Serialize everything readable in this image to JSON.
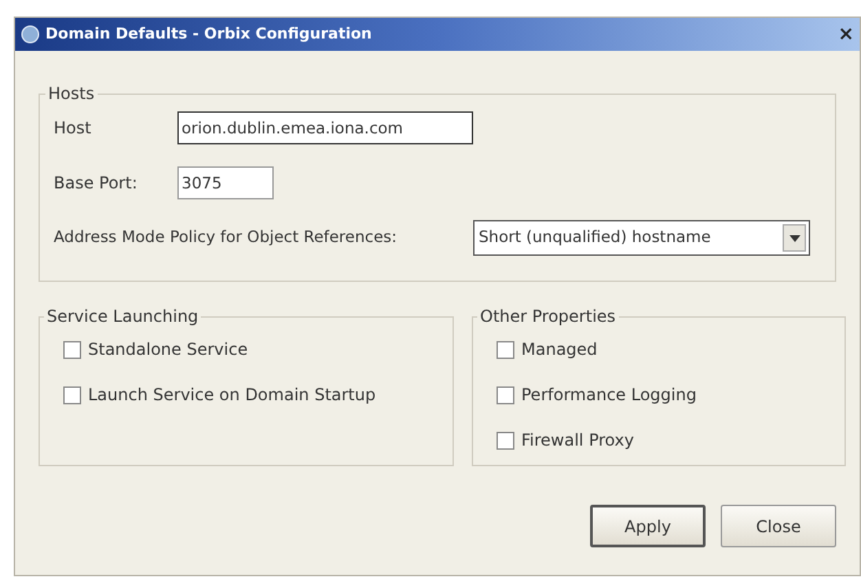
{
  "window": {
    "title": "Domain Defaults - Orbix Configuration",
    "close": "×"
  },
  "hosts": {
    "title": "Hosts",
    "fields": [
      {
        "label": "Host",
        "value": "orion.dublin.emea.iona.com",
        "focused": true
      },
      {
        "label": "Base Port:",
        "value": "3075",
        "focused": false
      }
    ],
    "policy": {
      "label": "Address Mode Policy for Object References:",
      "value": "Short (unqualified) hostname"
    }
  },
  "groups": [
    {
      "title": "Service Launching",
      "checkboxes": [
        {
          "label": "Standalone Service",
          "checked": false
        },
        {
          "label": "Launch Service on Domain Startup",
          "checked": false
        }
      ]
    },
    {
      "title": "Other Properties",
      "checkboxes": [
        {
          "label": "Managed",
          "checked": false
        },
        {
          "label": "Performance Logging",
          "checked": false
        },
        {
          "label": "Firewall Proxy",
          "checked": false
        }
      ]
    }
  ],
  "buttons": [
    {
      "label": "Apply",
      "default": true
    },
    {
      "label": "Close",
      "default": false
    }
  ]
}
